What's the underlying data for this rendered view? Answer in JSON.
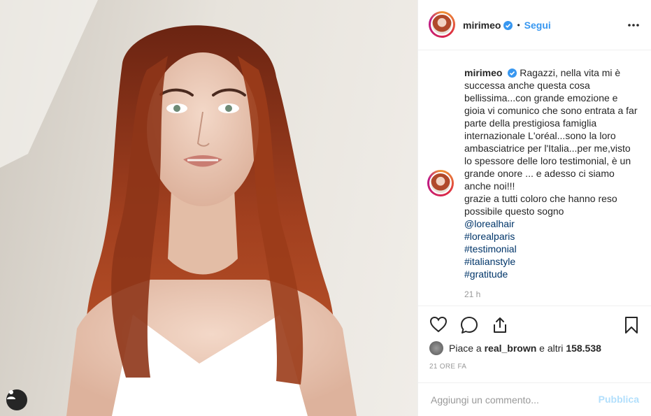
{
  "post": {
    "username": "mirimeo",
    "follow_label": "Segui",
    "separator": "•",
    "caption_username": "mirimeo",
    "caption_text": "Ragazzi, nella vita mi è successa anche questa cosa bellissima...con grande emozione e gioia vi comunico che sono entrata a far parte della prestigiosa famiglia internazionale L'oréal...sono la loro ambasciatrice per l'Italia...per me,visto lo spessore delle loro testimonial, è un grande onore ... e adesso ci siamo anche noi!!!\ngrazie a tutti coloro che hanno reso possibile questo sogno",
    "tags": [
      "@lorealhair",
      "#lorealparis",
      "#testimonial",
      "#italianstyle",
      "#gratitude"
    ],
    "caption_time": "21 h",
    "likes_prefix": "Piace a ",
    "likes_user": "real_brown",
    "likes_middle": " e altri ",
    "likes_count": "158.538",
    "posted_ago": "21 ORE FA",
    "comment_placeholder": "Aggiungi un commento...",
    "publish_label": "Pubblica"
  },
  "icons": {
    "verified": "verified-badge-icon",
    "more": "more-options-icon",
    "like": "heart-icon",
    "comment": "comment-bubble-icon",
    "share": "share-icon",
    "save": "bookmark-icon",
    "user_tags": "user-tags-icon"
  },
  "colors": {
    "link": "#003569",
    "accent": "#3897f0",
    "publish_disabled": "#b2dffc",
    "muted": "#999999"
  }
}
